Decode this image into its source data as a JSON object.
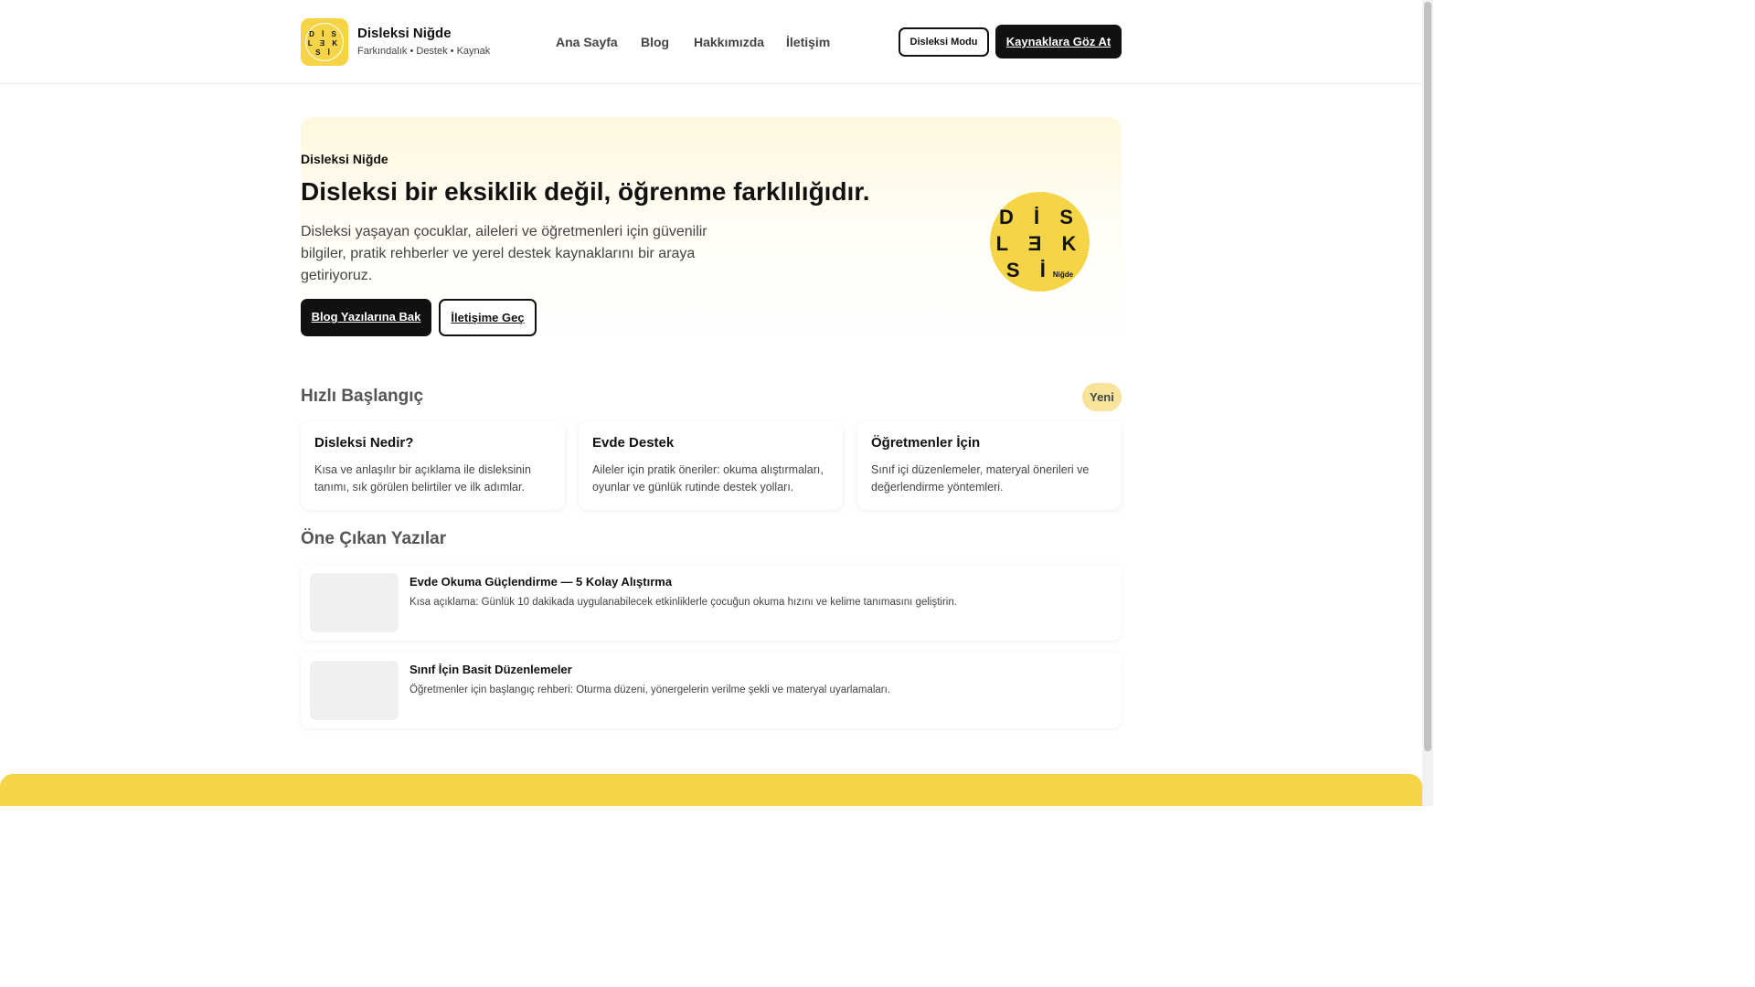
{
  "header": {
    "logo_letters": [
      "D İ S",
      "L Ǝ K",
      "S İ"
    ],
    "brand_title": "Disleksi Niğde",
    "brand_subtitle": "Farkındalık • Destek • Kaynak",
    "nav": [
      "Ana Sayfa",
      "Blog",
      "Hakkımızda",
      "İletişim"
    ],
    "dyslexia_mode_label": "Disleksi Modu",
    "cta_label": "Kaynaklara Göz At"
  },
  "hero": {
    "kicker": "Disleksi Niğde",
    "title": "Disleksi bir eksiklik değil, öğrenme farklılığıdır.",
    "description": "Disleksi yaşayan çocuklar, aileleri ve öğretmenleri için güvenilir bilgiler, pratik rehberler ve yerel destek kaynaklarını bir araya getiriyoruz.",
    "primary_button": "Blog Yazılarına Bak",
    "secondary_button": "İletişime Geç",
    "logo_letters": [
      "D İ S",
      "L Ǝ K",
      "S İ"
    ],
    "logo_small": "Niğde"
  },
  "quick_start": {
    "title": "Hızlı Başlangıç",
    "badge": "Yeni",
    "cards": [
      {
        "title": "Disleksi Nedir?",
        "text": "Kısa ve anlaşılır bir açıklama ile disleksinin tanımı, sık görülen belirtiler ve ilk adımlar."
      },
      {
        "title": "Evde Destek",
        "text": "Aileler için pratik öneriler: okuma alıştırmaları, oyunlar ve günlük rutinde destek yolları."
      },
      {
        "title": "Öğretmenler İçin",
        "text": "Sınıf içi düzenlemeler, materyal önerileri ve değerlendirme yöntemleri."
      }
    ]
  },
  "featured": {
    "title": "Öne Çıkan Yazılar",
    "posts": [
      {
        "title": "Evde Okuma Güçlendirme — 5 Kolay Alıştırma",
        "text": "Kısa açıklama: Günlük 10 dakikada uygulanabilecek etkinliklerle çocuğun okuma hızını ve kelime tanımasını geliştirin."
      },
      {
        "title": "Sınıf İçin Basit Düzenlemeler",
        "text": "Öğretmenler için başlangıç rehberi: Oturma düzeni, yönergelerin verilme şekli ve materyal uyarlamaları."
      }
    ]
  },
  "colors": {
    "accent": "#f5d547",
    "dark": "#111111",
    "badge": "#f7e39a"
  }
}
